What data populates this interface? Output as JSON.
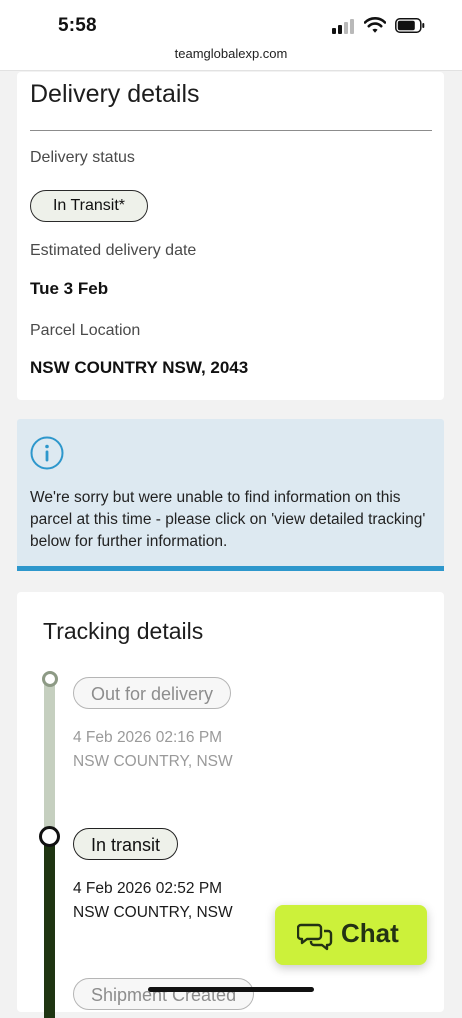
{
  "status_bar": {
    "time": "5:58"
  },
  "browser": {
    "url": "teamglobalexp.com"
  },
  "delivery": {
    "title": "Delivery details",
    "status_label": "Delivery status",
    "status_value": "In Transit*",
    "eta_label": "Estimated delivery date",
    "eta_value": "Tue 3 Feb",
    "location_label": "Parcel Location",
    "location_value": "NSW COUNTRY NSW, 2043"
  },
  "notice": {
    "icon": "info-icon",
    "message": "We're sorry but were unable to find information on this parcel at this time - please click on 'view detailed tracking' below for further information."
  },
  "tracking": {
    "title": "Tracking details",
    "events": [
      {
        "status": "Out for delivery",
        "datetime": "4 Feb 2026 02:16 PM",
        "location": "NSW COUNTRY, NSW"
      },
      {
        "status": "In transit",
        "datetime": "4 Feb 2026 02:52 PM",
        "location": "NSW COUNTRY, NSW"
      },
      {
        "status": "Shipment Created"
      }
    ]
  },
  "chat": {
    "label": "Chat",
    "icon": "chat-bubbles-icon"
  },
  "colors": {
    "accent_green": "#ccf13a",
    "info_blue": "#2d97cc",
    "timeline_dark": "#1f3512"
  }
}
